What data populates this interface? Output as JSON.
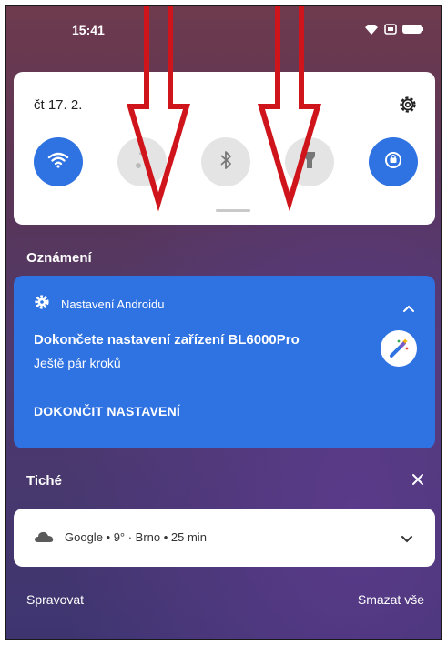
{
  "status_bar": {
    "time": "15:41",
    "icons": [
      "wifi-icon",
      "sim-icon",
      "battery-icon"
    ]
  },
  "quick_settings": {
    "date": "čt 17. 2.",
    "settings_icon": "gear-icon",
    "tiles": [
      {
        "name": "wifi",
        "icon": "wifi-icon",
        "state": "on"
      },
      {
        "name": "sound",
        "icon": "music-icon",
        "state": "off"
      },
      {
        "name": "bluetooth",
        "icon": "bluetooth-icon",
        "state": "off"
      },
      {
        "name": "flashlight",
        "icon": "flashlight-icon",
        "state": "off"
      },
      {
        "name": "auto-rotate",
        "icon": "rotate-icon",
        "state": "on"
      }
    ]
  },
  "notifications": {
    "section_label": "Oznámení",
    "card": {
      "app_name": "Nastavení Androidu",
      "title": "Dokončete nastavení zařízení BL6000Pro",
      "subtitle": "Ještě pár kroků",
      "action": "DOKONČIT NASTAVENÍ"
    }
  },
  "silent": {
    "section_label": "Tiché",
    "weather": "Google • 9° · Brno • 25 min"
  },
  "footer": {
    "manage": "Spravovat",
    "clear_all": "Smazat vše"
  },
  "colors": {
    "accent": "#2f72e2",
    "annotation_arrow": "#d0141c"
  }
}
